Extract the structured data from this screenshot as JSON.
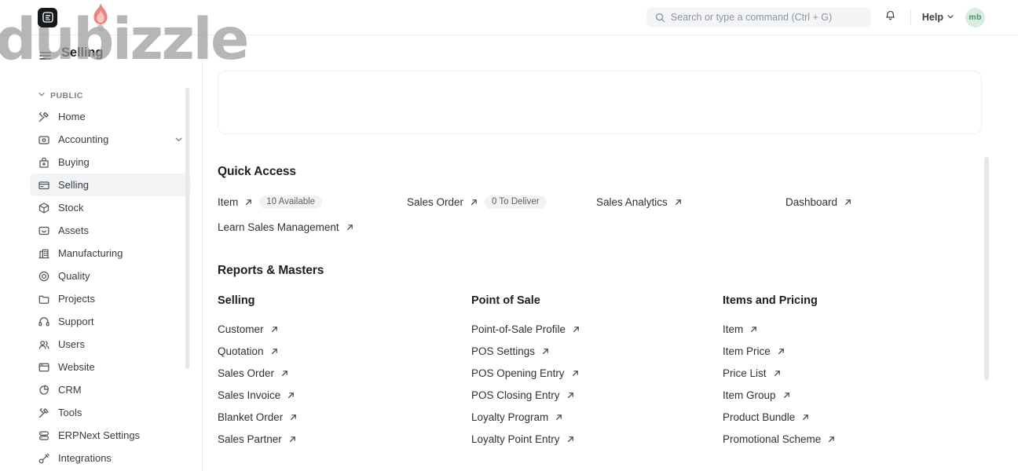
{
  "navbar": {
    "logo_icon": "erpnext-logo-icon",
    "search": {
      "icon": "search-icon",
      "placeholder": "Search or type a command (Ctrl + G)",
      "value": ""
    },
    "notifications_icon": "bell-icon",
    "help_label": "Help",
    "help_chevron_icon": "chevron-down-icon",
    "avatar_initials": "mb",
    "avatar_bg": "#d9ece0",
    "avatar_color": "#4e8d68"
  },
  "page": {
    "title": "Selling",
    "menu_icon": "hamburger-icon"
  },
  "sidebar": {
    "section_label": "PUBLIC",
    "section_chevron_icon": "chevron-down-icon",
    "items": [
      {
        "label": "Home",
        "icon": "tools-icon",
        "active": false,
        "expandable": false
      },
      {
        "label": "Accounting",
        "icon": "wallet-icon",
        "active": false,
        "expandable": true
      },
      {
        "label": "Buying",
        "icon": "bag-icon",
        "active": false,
        "expandable": false
      },
      {
        "label": "Selling",
        "icon": "card-icon",
        "active": true,
        "expandable": false
      },
      {
        "label": "Stock",
        "icon": "box-icon",
        "active": false,
        "expandable": false
      },
      {
        "label": "Assets",
        "icon": "asset-icon",
        "active": false,
        "expandable": false
      },
      {
        "label": "Manufacturing",
        "icon": "factory-icon",
        "active": false,
        "expandable": false
      },
      {
        "label": "Quality",
        "icon": "target-icon",
        "active": false,
        "expandable": false
      },
      {
        "label": "Projects",
        "icon": "folder-icon",
        "active": false,
        "expandable": false
      },
      {
        "label": "Support",
        "icon": "headset-icon",
        "active": false,
        "expandable": false
      },
      {
        "label": "Users",
        "icon": "users-icon",
        "active": false,
        "expandable": false
      },
      {
        "label": "Website",
        "icon": "browser-icon",
        "active": false,
        "expandable": false
      },
      {
        "label": "CRM",
        "icon": "pie-chart-icon",
        "active": false,
        "expandable": false
      },
      {
        "label": "Tools",
        "icon": "wrench-icon",
        "active": false,
        "expandable": false
      },
      {
        "label": "ERPNext Settings",
        "icon": "server-icon",
        "active": false,
        "expandable": false
      },
      {
        "label": "Integrations",
        "icon": "plug-icon",
        "active": false,
        "expandable": false
      }
    ]
  },
  "main": {
    "quick_access": {
      "title": "Quick Access",
      "links": [
        {
          "label": "Item",
          "badge": "10 Available"
        },
        {
          "label": "Sales Order",
          "badge": "0 To Deliver"
        },
        {
          "label": "Sales Analytics",
          "badge": ""
        },
        {
          "label": "Dashboard",
          "badge": ""
        },
        {
          "label": "Learn Sales Management",
          "badge": ""
        }
      ]
    },
    "reports_masters": {
      "title": "Reports & Masters",
      "columns": [
        {
          "title": "Selling",
          "links": [
            "Customer",
            "Quotation",
            "Sales Order",
            "Sales Invoice",
            "Blanket Order",
            "Sales Partner"
          ]
        },
        {
          "title": "Point of Sale",
          "links": [
            "Point-of-Sale Profile",
            "POS Settings",
            "POS Opening Entry",
            "POS Closing Entry",
            "Loyalty Program",
            "Loyalty Point Entry"
          ]
        },
        {
          "title": "Items and Pricing",
          "links": [
            "Item",
            "Item Price",
            "Price List",
            "Item Group",
            "Product Bundle",
            "Promotional Scheme"
          ]
        }
      ]
    }
  },
  "watermark": {
    "text": "dubizzle",
    "flame_icon": "flame-icon",
    "text_color": "#9a9a9a",
    "flame_color": "#e8736a"
  }
}
